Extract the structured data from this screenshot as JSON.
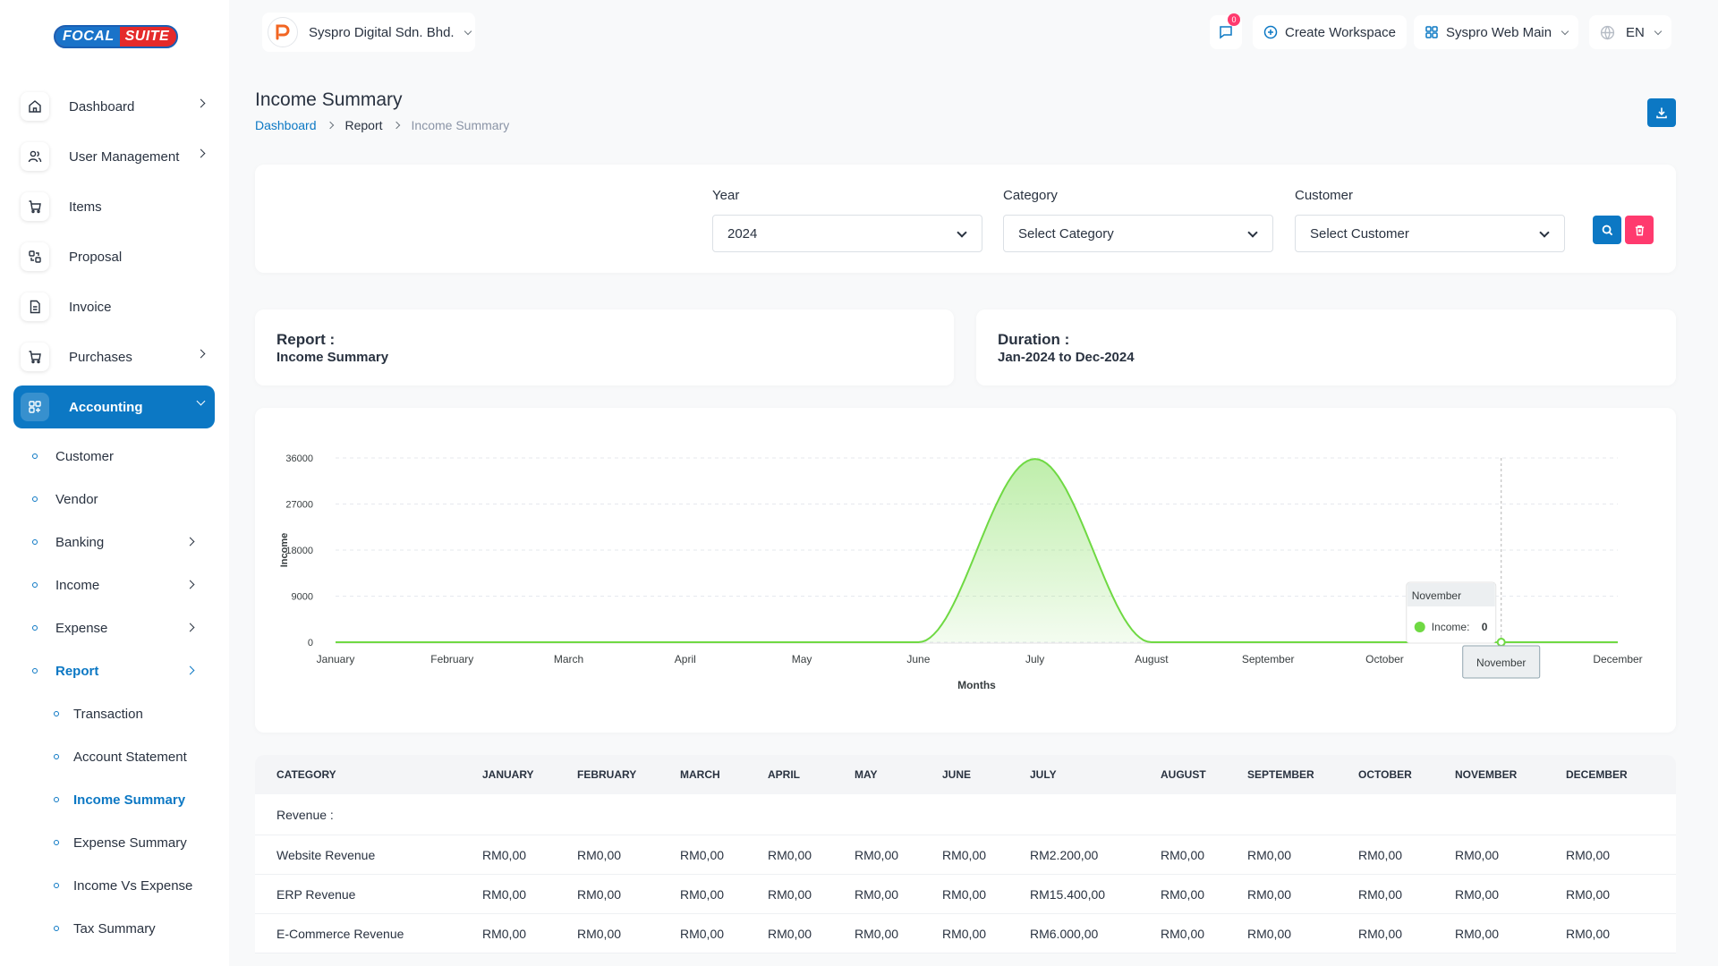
{
  "brand": {
    "part1": "FOCAL",
    "part2": "SUITE"
  },
  "sidebar": {
    "items": [
      {
        "label": "Dashboard",
        "icon": "home-icon"
      },
      {
        "label": "User Management",
        "icon": "users-icon"
      },
      {
        "label": "Items",
        "icon": "cart-icon"
      },
      {
        "label": "Proposal",
        "icon": "proposal-icon"
      },
      {
        "label": "Invoice",
        "icon": "invoice-icon"
      },
      {
        "label": "Purchases",
        "icon": "cart-icon"
      },
      {
        "label": "Accounting",
        "icon": "grid-icon"
      }
    ],
    "accounting_sub": [
      "Customer",
      "Vendor",
      "Banking",
      "Income",
      "Expense",
      "Report"
    ],
    "report_sub": [
      "Transaction",
      "Account Statement",
      "Income Summary",
      "Expense Summary",
      "Income Vs Expense",
      "Tax Summary"
    ]
  },
  "topbar": {
    "company": "Syspro Digital Sdn. Bhd.",
    "notif_count": "0",
    "create_workspace": "Create Workspace",
    "workspace": "Syspro Web Main",
    "language": "EN"
  },
  "page": {
    "title": "Income Summary",
    "breadcrumb": [
      "Dashboard",
      "Report",
      "Income Summary"
    ]
  },
  "filters": {
    "year_label": "Year",
    "year_value": "2024",
    "category_label": "Category",
    "category_value": "Select Category",
    "customer_label": "Customer",
    "customer_value": "Select Customer"
  },
  "info": {
    "report_label": "Report :",
    "report_value": "Income Summary",
    "duration_label": "Duration :",
    "duration_value": "Jan-2024 to Dec-2024"
  },
  "chart_data": {
    "type": "area",
    "x": [
      "January",
      "February",
      "March",
      "April",
      "May",
      "June",
      "July",
      "August",
      "September",
      "October",
      "November",
      "December"
    ],
    "series": [
      {
        "name": "Income",
        "values": [
          0,
          0,
          0,
          0,
          0,
          0,
          35800,
          0,
          0,
          0,
          0,
          0
        ],
        "color": "#6fd943"
      }
    ],
    "yticks": [
      "0",
      "9000",
      "18000",
      "27000",
      "36000"
    ],
    "ylim": [
      0,
      36000
    ],
    "xlabel": "Months",
    "ylabel": "Income",
    "tooltip": {
      "title": "November",
      "label": "Income:",
      "value": "0"
    },
    "grid": true
  },
  "table": {
    "headers": [
      "Category",
      "January",
      "February",
      "March",
      "April",
      "May",
      "June",
      "July",
      "August",
      "September",
      "October",
      "November",
      "December"
    ],
    "section": "Revenue :",
    "rows": [
      {
        "name": "Website Revenue",
        "values": [
          "RM0,00",
          "RM0,00",
          "RM0,00",
          "RM0,00",
          "RM0,00",
          "RM0,00",
          "RM2.200,00",
          "RM0,00",
          "RM0,00",
          "RM0,00",
          "RM0,00",
          "RM0,00"
        ]
      },
      {
        "name": "ERP Revenue",
        "values": [
          "RM0,00",
          "RM0,00",
          "RM0,00",
          "RM0,00",
          "RM0,00",
          "RM0,00",
          "RM15.400,00",
          "RM0,00",
          "RM0,00",
          "RM0,00",
          "RM0,00",
          "RM0,00"
        ]
      },
      {
        "name": "E-Commerce Revenue",
        "values": [
          "RM0,00",
          "RM0,00",
          "RM0,00",
          "RM0,00",
          "RM0,00",
          "RM0,00",
          "RM6.000,00",
          "RM0,00",
          "RM0,00",
          "RM0,00",
          "RM0,00",
          "RM0,00"
        ]
      }
    ]
  }
}
